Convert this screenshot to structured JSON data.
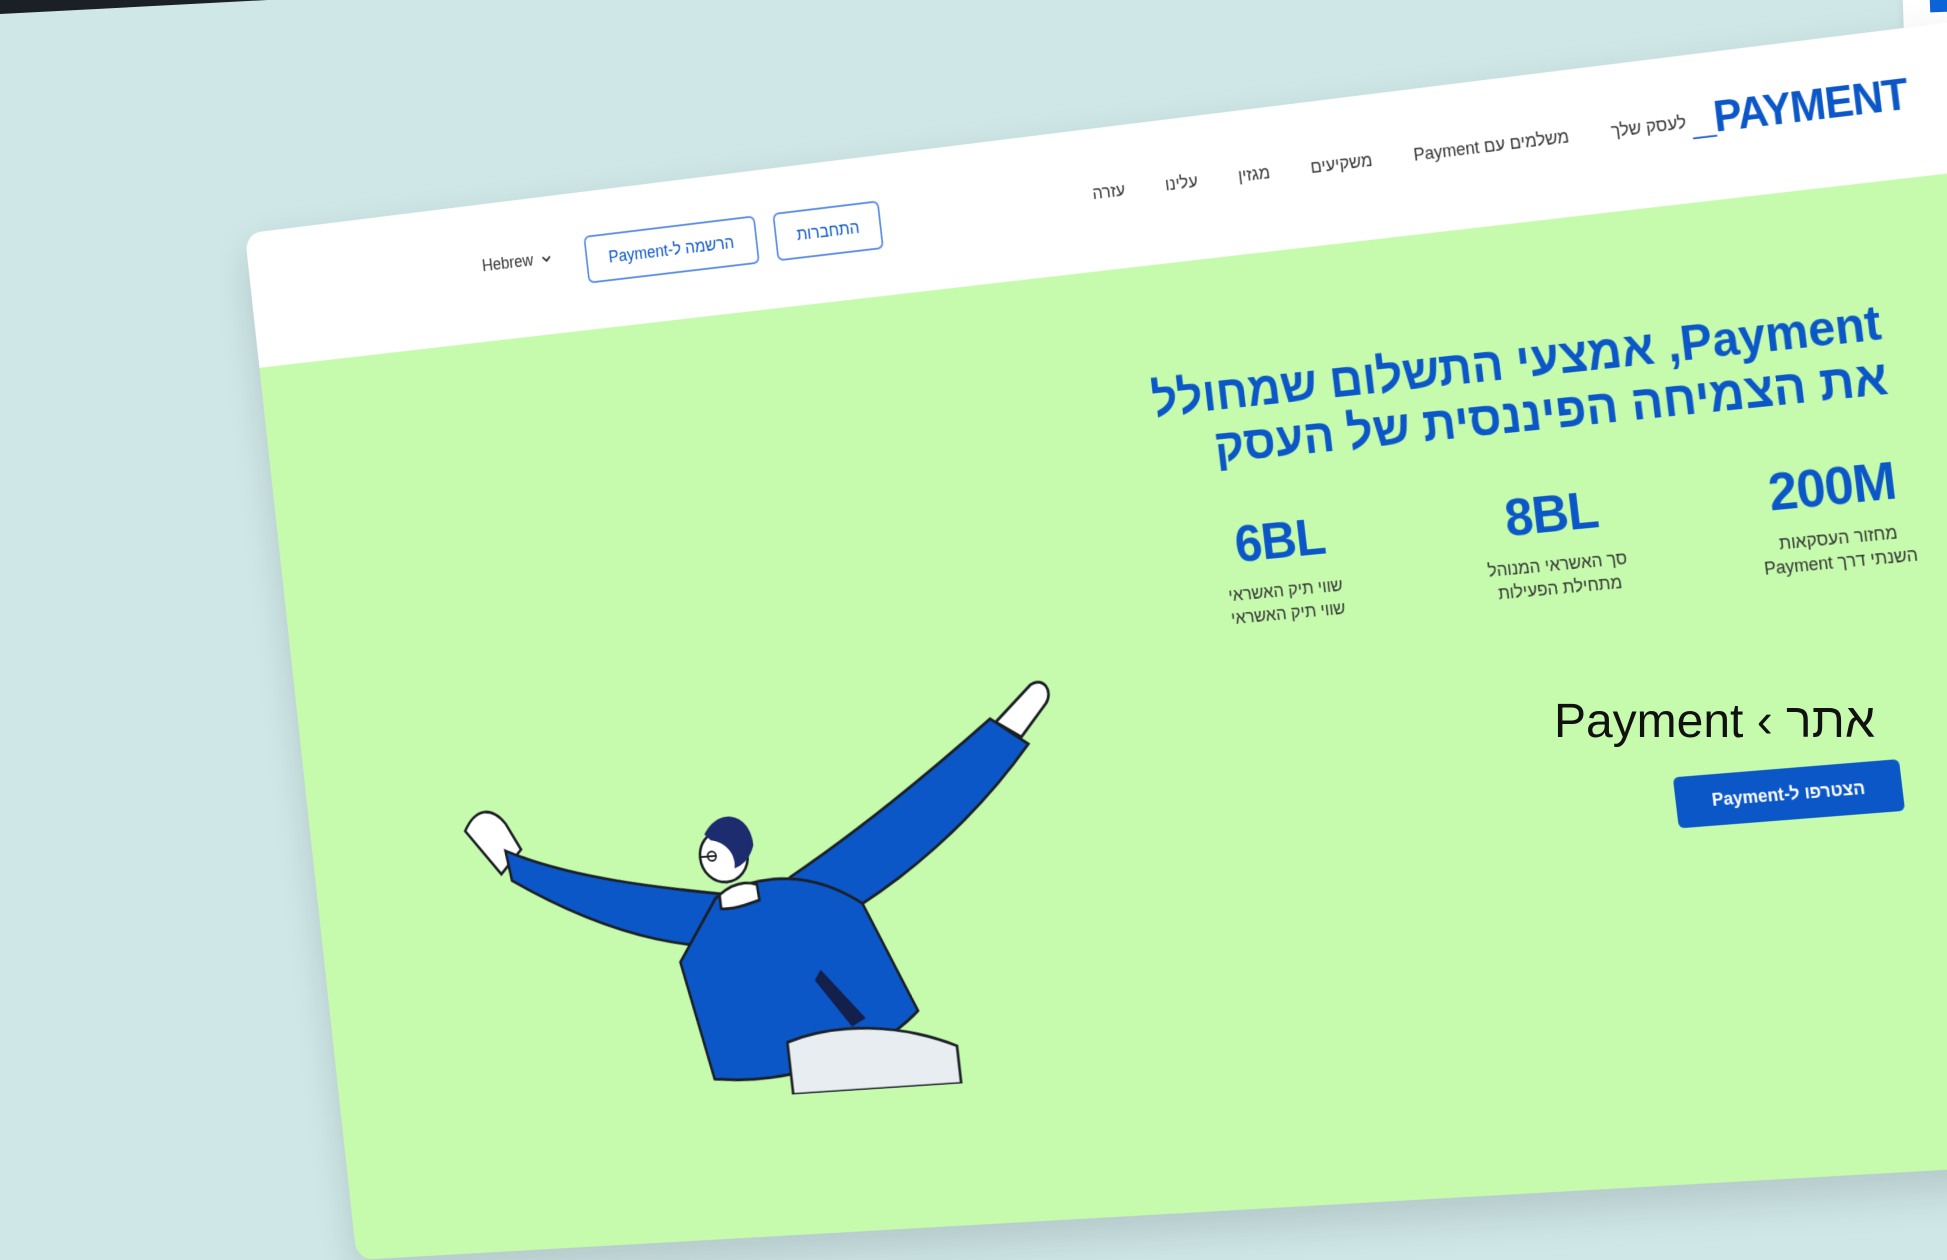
{
  "header": {
    "logo": "PAYMENT_",
    "nav": [
      "לעסק שלך",
      "משלמים עם Payment",
      "משקיעים",
      "מגזין",
      "עלינו",
      "עזרה"
    ],
    "login_label": "התחברות",
    "register_label": "הרשמה ל-Payment",
    "language_label": "Hebrew"
  },
  "hero": {
    "title": "Payment, אמצעי התשלום שמחולל\nאת הצמיחה הפיננסית של העסק",
    "stats": [
      {
        "value": "200M",
        "label": "מחזור העסקאות\nהשנתי דרך Payment"
      },
      {
        "value": "8BL",
        "label": "סך האשראי המנוהל\nמתחילת הפעילות"
      },
      {
        "value": "6BL",
        "label": "שווי תיק האשראי\nשווי תיק האשראי"
      }
    ],
    "cta_label": "הצטרפו ל-Payment"
  },
  "caption": "Payment ‹ אתר",
  "colors": {
    "brand": "#0b57c8",
    "hero_bg": "#c6fbad",
    "header_bg": "#ffffff",
    "backdrop": "#cfe7e7"
  },
  "icons": {
    "language_chevron": "chevron-down-icon",
    "illustration": "person-flying-illustration"
  }
}
